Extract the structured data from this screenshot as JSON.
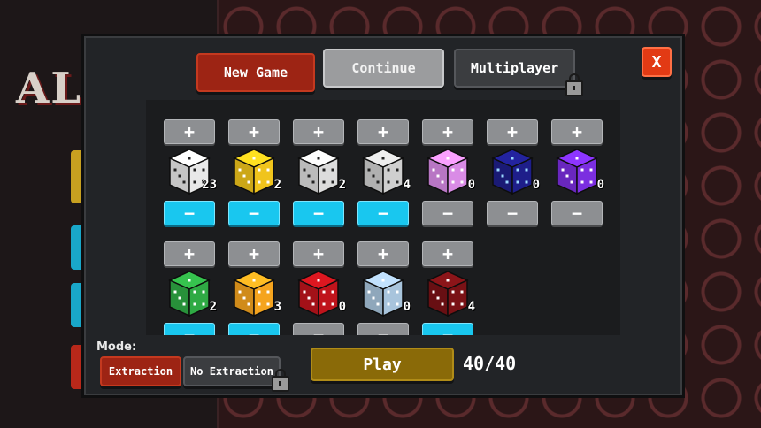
{
  "background": {
    "title": "AL"
  },
  "menu": {
    "new_game": "New Game",
    "continue": "Continue",
    "multiplayer": "Multiplayer",
    "close": "X"
  },
  "dice_grid": {
    "plus_label": "+",
    "minus_label": "−",
    "row1": [
      {
        "name": "white-die",
        "color": "#e8e8e8",
        "pip": "#222",
        "count": "23",
        "minus_active": true
      },
      {
        "name": "yellow-die",
        "color": "#f0c41c",
        "pip": "#fff",
        "count": "2",
        "minus_active": true
      },
      {
        "name": "white-d8-die",
        "color": "#dcdcdc",
        "pip": "#222",
        "count": "2",
        "minus_active": true
      },
      {
        "name": "white-d10-die",
        "color": "#cfcfcf",
        "pip": "#222",
        "count": "4",
        "minus_active": true
      },
      {
        "name": "pink-die",
        "color": "#d98be6",
        "pip": "#fff",
        "count": "0",
        "minus_active": false
      },
      {
        "name": "galaxy-die",
        "color": "#1e1e8a",
        "pip": "#9ad8ff",
        "count": "0",
        "minus_active": false
      },
      {
        "name": "purple-die",
        "color": "#7b2ee0",
        "pip": "#fff",
        "count": "0",
        "minus_active": false
      }
    ],
    "row2": [
      {
        "name": "green-die",
        "color": "#2faa44",
        "pip": "#fff",
        "count": "2",
        "minus_active": true
      },
      {
        "name": "orange-die",
        "color": "#f5a41e",
        "pip": "#fff",
        "count": "3",
        "minus_active": true
      },
      {
        "name": "red-black-die",
        "color": "#c0141c",
        "pip": "#fff",
        "count": "0",
        "minus_active": false
      },
      {
        "name": "light-blue-die",
        "color": "#a8c4dc",
        "pip": "#fff",
        "count": "0",
        "minus_active": false
      },
      {
        "name": "dark-red-die",
        "color": "#7a1216",
        "pip": "#fff",
        "count": "4",
        "minus_active": true
      }
    ]
  },
  "mode": {
    "label": "Mode:",
    "extraction": "Extraction",
    "no_extraction": "No Extraction"
  },
  "play": {
    "label": "Play",
    "capacity": "40/40"
  }
}
